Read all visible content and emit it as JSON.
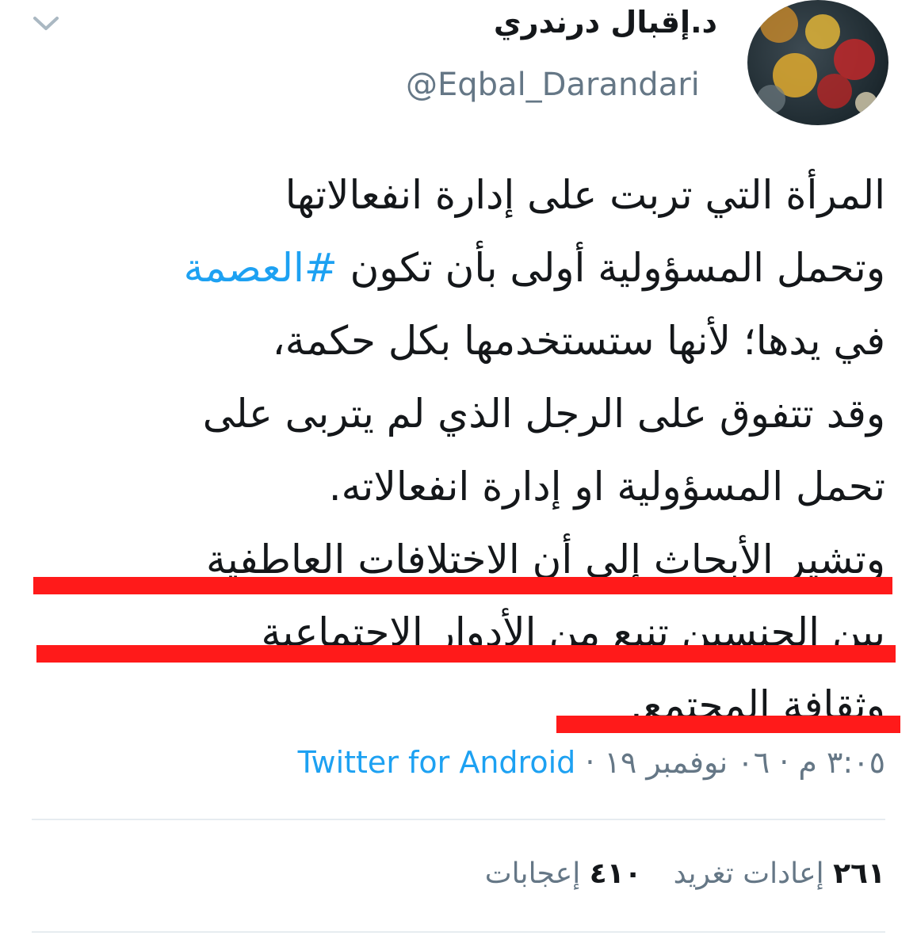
{
  "tweet": {
    "display_name": "د.إقبال درندري",
    "handle": "@Eqbal_Darandari",
    "avatar_icon": "avatar-bokeh-image",
    "menu_icon": "chevron-down-icon",
    "lines": [
      {
        "text": "المرأة التي تربت على إدارة انفعالاتها"
      },
      {
        "text": "وتحمل المسؤولية أولى بأن تكون ",
        "hashtag": "#العصمة"
      },
      {
        "text": "في يدها؛ لأنها ستستخدمها بكل حكمة،"
      },
      {
        "text": "وقد تتفوق على الرجل الذي لم يتربى على"
      },
      {
        "text": "تحمل المسؤولية او إدارة انفعالاته."
      },
      {
        "text": "وتشير الأبحاث إلى أن الاختلافات العاطفية"
      },
      {
        "text": "بين الجنسين تنبع من الأدوار الاجتماعية"
      },
      {
        "text": "وثقافة المجتمع."
      }
    ],
    "hashtag_color": "#1da1f2",
    "underline_color": "#ff1a1a",
    "timestamp": "٣:٠٥ م · ٠٦ نوفمبر ١٩ · ",
    "source": "Twitter for Android",
    "stats": {
      "retweets_count": "٢٦١",
      "retweets_label": "إعادات تغريد",
      "likes_count": "٤١٠",
      "likes_label": "إعجابات"
    }
  }
}
